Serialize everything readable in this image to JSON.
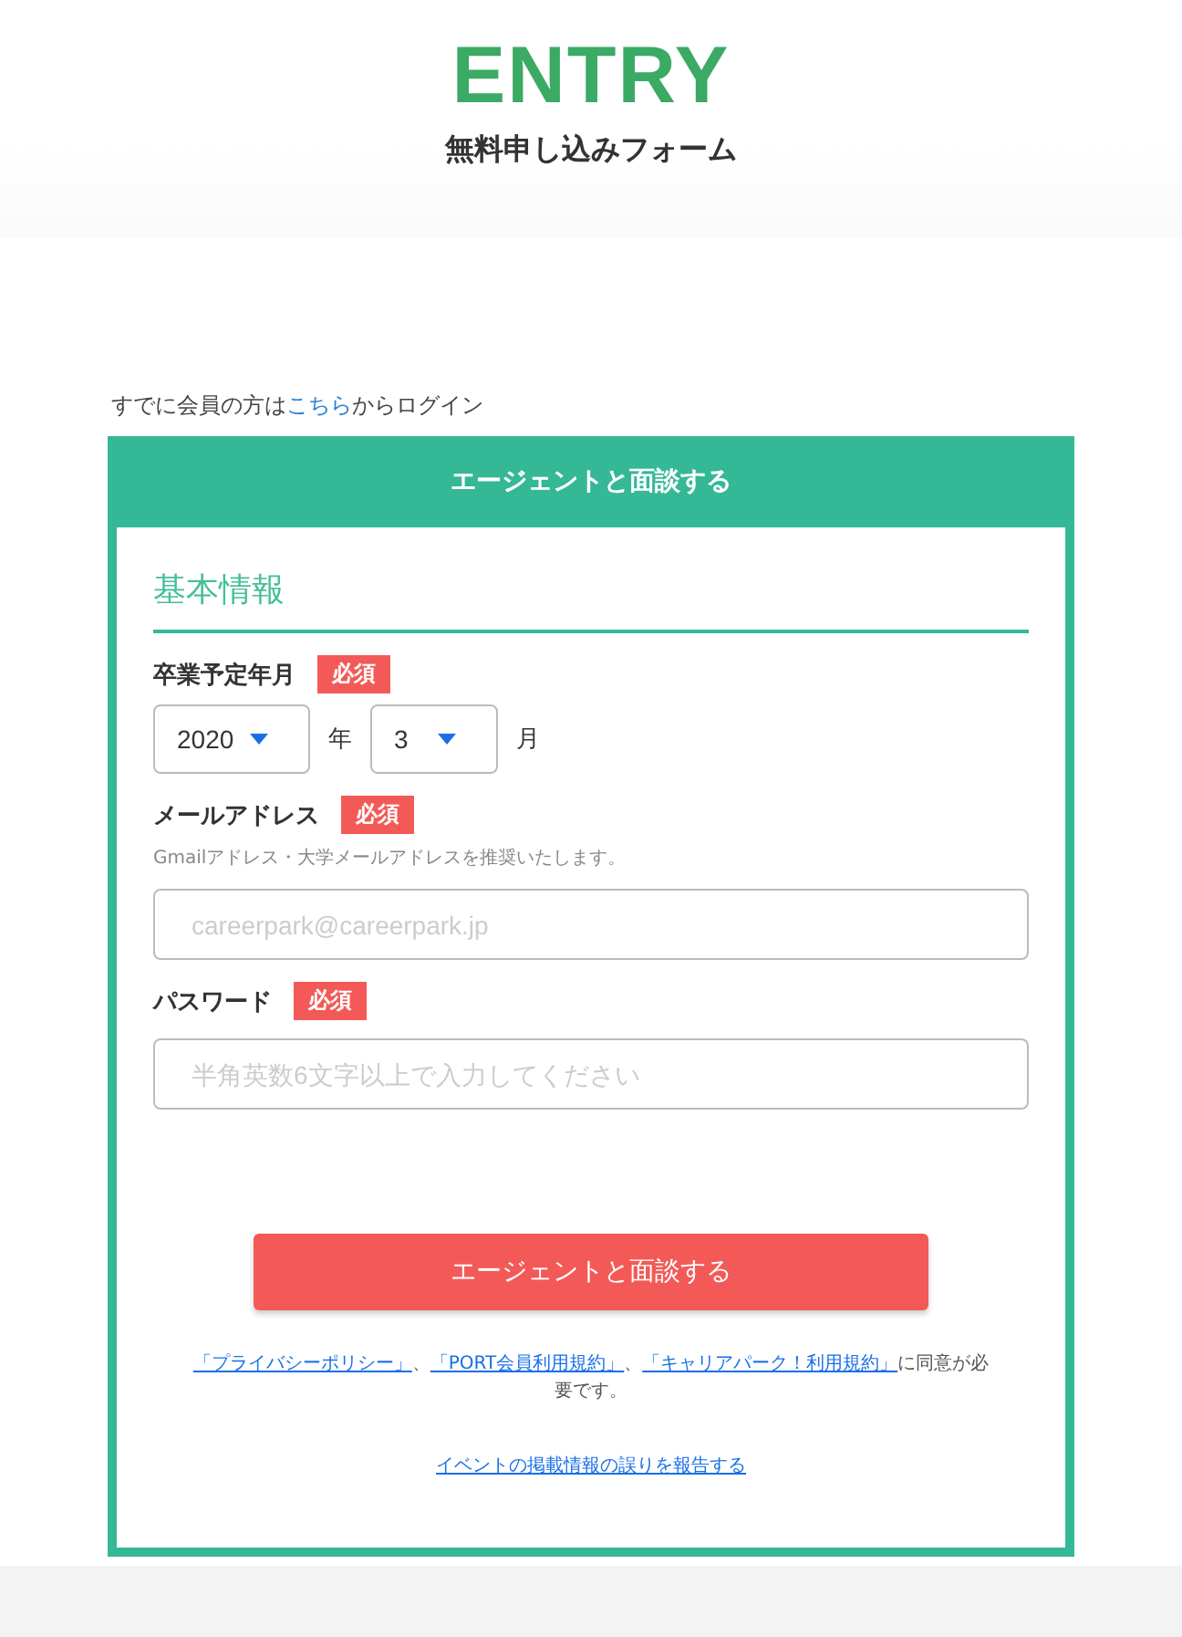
{
  "header": {
    "title": "ENTRY",
    "subtitle": "無料申し込みフォーム"
  },
  "login": {
    "before": "すでに会員の方は",
    "link": "こちら",
    "after": "からログイン"
  },
  "card": {
    "title": "エージェントと面談する",
    "section": "基本情報",
    "fields": [
      {
        "kind": "date",
        "label": "卒業予定年月",
        "required": true,
        "badge": "必須",
        "year": "2020",
        "year_unit": "年",
        "month": "3",
        "month_unit": "月"
      },
      {
        "kind": "email",
        "label": "メールアドレス",
        "required": true,
        "badge": "必須",
        "note": "Gmailアドレス・大学メールアドレスを推奨いたします。",
        "placeholder": "careerpark@careerpark.jp"
      },
      {
        "kind": "password",
        "label": "パスワード",
        "required": true,
        "badge": "必須",
        "placeholder": "半角英数6文字以上で入力してください"
      }
    ],
    "submit": "エージェントと面談する",
    "agreement": [
      {
        "kind": "link",
        "text": "「プライバシーポリシー」"
      },
      {
        "kind": "text",
        "text": "、"
      },
      {
        "kind": "link",
        "text": "「PORT会員利用規約」"
      },
      {
        "kind": "text",
        "text": "、"
      },
      {
        "kind": "link",
        "text": "「キャリアパーク！利用規約」"
      },
      {
        "kind": "text",
        "text": "に同意が必要です。"
      }
    ],
    "report": "イベントの掲載情報の誤りを報告する"
  }
}
